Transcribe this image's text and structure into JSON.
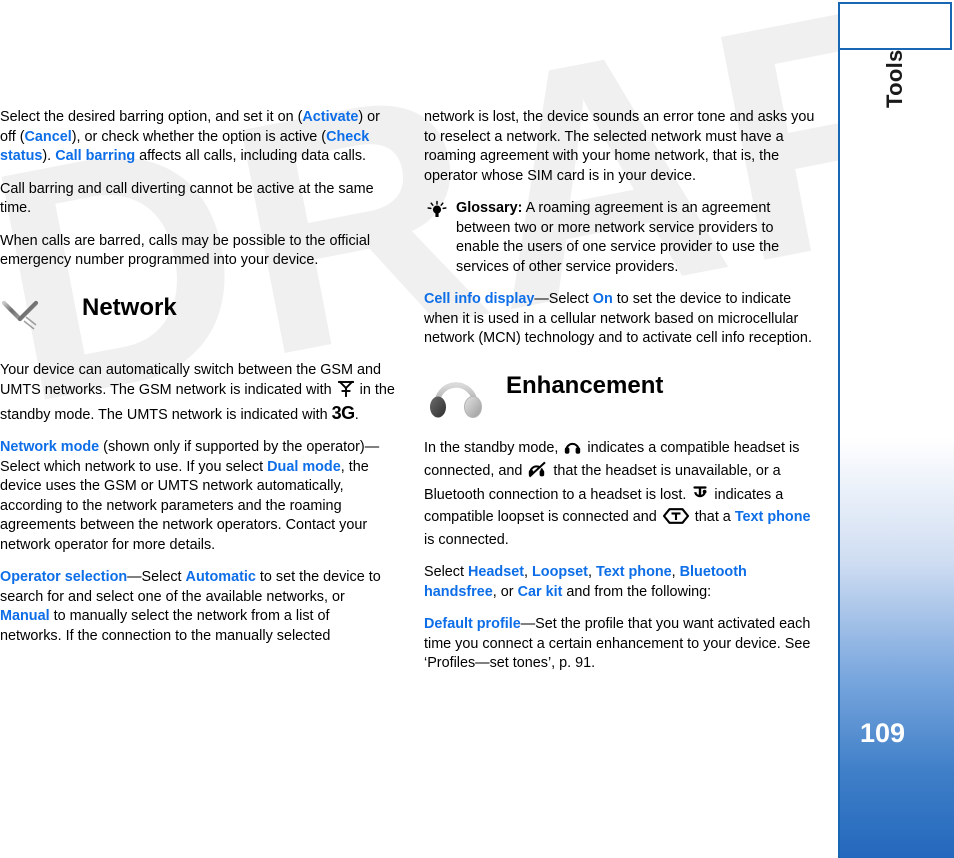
{
  "watermark": {
    "text": "DRAFT"
  },
  "sidebar": {
    "chapter_label": "Tools",
    "page_number": "109",
    "accent_color": "#1767b2",
    "gradient_bottom_color": "#2468bd"
  },
  "theme": {
    "link_color": "#0d6ee8",
    "text_color": "#000000",
    "icon_gray": "#8c8c8c"
  },
  "left_column": {
    "paragraph_1": {
      "part_1": "Select the desired barring option, and set it on (",
      "link_1": "Activate",
      "part_2": ") or off (",
      "link_2": "Cancel",
      "part_3": "), or check whether the option is active (",
      "link_3": "Check status",
      "part_4": "). ",
      "link_4": "Call barring",
      "part_5": " affects all calls, including data calls."
    },
    "paragraph_2": "Call barring and call diverting cannot be active at the same time.",
    "paragraph_3": "When calls are barred, calls may be possible to the official emergency number programmed into your device.",
    "section_heading": "Network",
    "section_icon": "antenna-signal-icon",
    "paragraph_4": {
      "part_1": "Your device can automatically switch between the GSM and UMTS networks. The GSM network is indicated with ",
      "icon_1": "antenna-icon",
      "part_2": " in the standby mode. The UMTS network is indicated with ",
      "glyph_3g": "3G",
      "part_3": "."
    },
    "paragraph_5": {
      "link_1": "Network mode",
      "part_1": " (shown only if supported by the operator)—Select which network to use. If you select ",
      "link_2": "Dual mode",
      "part_2": ", the device uses the GSM or UMTS network automatically, according to the network parameters and the roaming agreements between the network operators. Contact your network operator for more details."
    },
    "paragraph_6": {
      "link_1": "Operator selection",
      "part_1": "—Select ",
      "link_2": "Automatic",
      "part_2": " to set the device to search for and select one of the available networks, or ",
      "link_3": "Manual",
      "part_3": " to manually select the network from a list of networks. If the connection to the manually selected"
    }
  },
  "right_column": {
    "paragraph_1": "network is lost, the device sounds an error tone and asks you to reselect a network. The selected network must have a roaming agreement with your home network, that is, the operator whose SIM card is in your device.",
    "glossary": {
      "icon": "tip-lightbulb-icon",
      "label": "Glossary:",
      "text": " A roaming agreement is an agreement between two or more network service providers to enable the users of one service provider to use the services of other service providers."
    },
    "paragraph_2": {
      "link_1": "Cell info display",
      "part_1": "—Select ",
      "link_2": "On",
      "part_2": " to set the device to indicate when it is used in a cellular network based on microcellular network (MCN) technology and to activate cell info reception."
    },
    "section_heading": "Enhancement",
    "section_icon": "headset-icon",
    "paragraph_3": {
      "part_1": "In the standby mode, ",
      "icon_1": "headset-icon",
      "part_2": " indicates a compatible headset is connected, and ",
      "icon_2": "headset-unavailable-icon",
      "part_3": " that the headset is unavailable, or a Bluetooth connection to a headset is lost. ",
      "icon_3": "loopset-icon",
      "part_4": " indicates a compatible loopset is connected and ",
      "icon_4": "text-phone-icon",
      "part_5": " that a ",
      "link_1": "Text phone",
      "part_6": " is connected."
    },
    "paragraph_4": {
      "part_1": "Select ",
      "link_1": "Headset",
      "part_2": ", ",
      "link_2": "Loopset",
      "part_3": ", ",
      "link_3": "Text phone",
      "part_4": ", ",
      "link_4": "Bluetooth handsfree",
      "part_5": ", or ",
      "link_5": "Car kit",
      "part_6": " and from the following:"
    },
    "paragraph_5": {
      "link_1": "Default profile",
      "part_1": "—Set the profile that you want activated each time you connect a certain enhancement to your device. See ‘Profiles—set tones’, p. 91."
    }
  }
}
